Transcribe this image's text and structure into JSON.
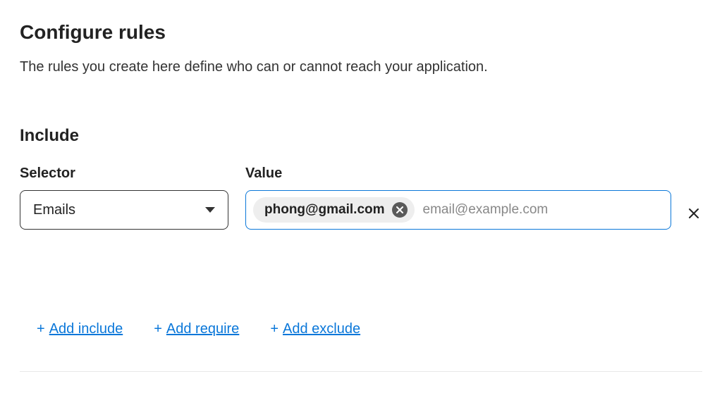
{
  "header": {
    "title": "Configure rules",
    "description": "The rules you create here define who can or cannot reach your application."
  },
  "include": {
    "title": "Include",
    "selector_label": "Selector",
    "value_label": "Value",
    "selector_value": "Emails",
    "chip_value": "phong@gmail.com",
    "value_placeholder": "email@example.com"
  },
  "actions": {
    "add_include": "Add include",
    "add_require": "Add require",
    "add_exclude": "Add exclude"
  }
}
